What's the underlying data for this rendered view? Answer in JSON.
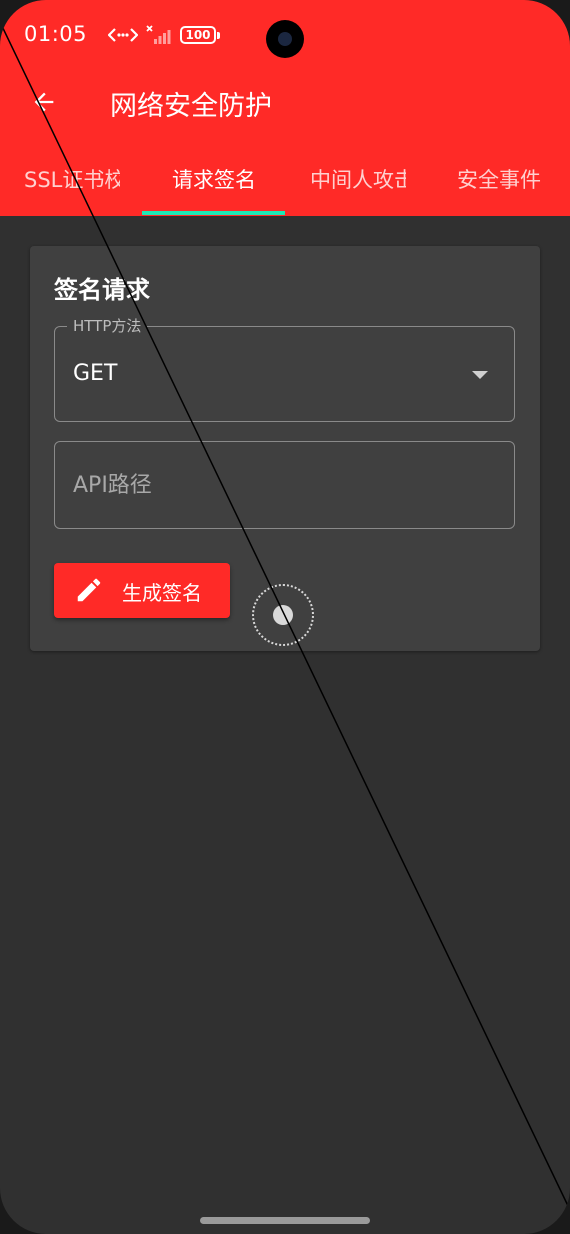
{
  "status_bar": {
    "time": "01:05",
    "battery": "100",
    "icons": [
      "network-speed-icon",
      "no-signal-icon",
      "battery-icon"
    ]
  },
  "app_bar": {
    "title": "网络安全防护",
    "back_icon": "arrow-left-icon"
  },
  "tabs": [
    {
      "label": "SSL证书校",
      "active": false
    },
    {
      "label": "请求签名",
      "active": true
    },
    {
      "label": "中间人攻击",
      "active": false
    },
    {
      "label": "安全事件",
      "active": false
    }
  ],
  "card": {
    "title": "签名请求",
    "method_field": {
      "label": "HTTP方法",
      "value": "GET"
    },
    "path_field": {
      "placeholder": "API路径",
      "value": ""
    },
    "generate_button": {
      "label": "生成签名",
      "icon": "pencil-icon"
    }
  },
  "colors": {
    "primary": "#ff2a27",
    "tab_indicator": "#1de9b6",
    "background": "#303030",
    "card": "#404040"
  }
}
